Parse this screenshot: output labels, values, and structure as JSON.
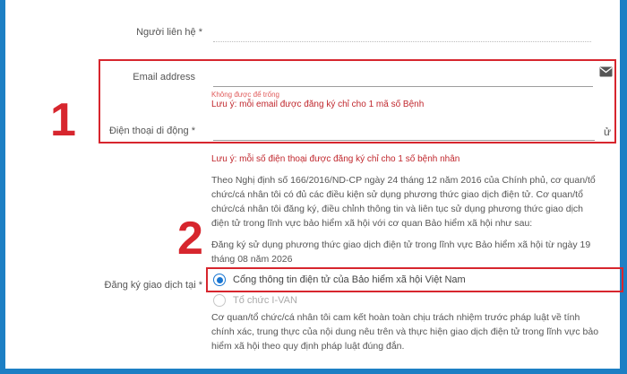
{
  "contact": {
    "label": "Người liên hệ",
    "required": "*"
  },
  "email": {
    "label": "Email address",
    "error": "Không được để trống",
    "note": "Lưu ý: mỗi email được đăng ký chỉ cho 1 mã số Bệnh"
  },
  "phone": {
    "label": "Điện thoại di động",
    "required": "*",
    "note": "Lưu ý: mỗi số điện thoại được đăng ký chỉ cho 1 số bệnh nhân",
    "suffix": "ử"
  },
  "terms": {
    "paragraph1": "Theo Nghị định số 166/2016/ND-CP ngày 24 tháng 12 năm 2016 của Chính phủ, cơ quan/tổ chức/cá nhân tôi có đủ các điều kiện sử dụng phương thức giao dịch điện tử. Cơ quan/tổ chức/cá nhân tôi đăng ký, điều chỉnh thông tin và liên tục sử dụng phương thức giao dịch điện tử trong lĩnh vực bảo hiểm xã hội với cơ quan Bảo hiểm xã hội như sau:",
    "paragraph2": "Đăng ký sử dụng phương thức giao dịch điện tử trong lĩnh vực Bảo hiểm xã hội từ ngày 19 tháng 08 năm 2026"
  },
  "register": {
    "label": "Đăng ký giao dịch tại",
    "required": "*",
    "options": [
      {
        "label": "Cổng thông tin điện tử của Bảo hiểm xã hội Việt Nam",
        "selected": true
      },
      {
        "label": "Tổ chức I-VAN",
        "selected": false
      }
    ],
    "commitment": "Cơ quan/tổ chức/cá nhân tôi cam kết hoàn toàn chịu trách nhiệm trước pháp luật về tính chính xác, trung thực của nội dung nêu trên và thực hiện giao dịch điện tử trong lĩnh vực bảo hiểm xã hội theo quy định pháp luật đúng đắn."
  },
  "annotations": {
    "step1": "1",
    "step2": "2"
  },
  "colors": {
    "frame": "#1d7fc4",
    "highlight": "#d7262e",
    "radio": "#1976d2"
  },
  "icons": {
    "email": "envelope-icon"
  }
}
